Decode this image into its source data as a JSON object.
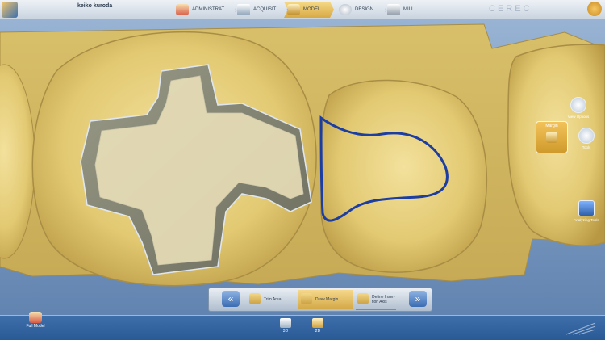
{
  "patient": {
    "name": "keiko kuroda"
  },
  "workflow": {
    "phases": [
      {
        "label": "ADMINISTRAT."
      },
      {
        "label": "ACQUISIT."
      },
      {
        "label": "MODEL"
      },
      {
        "label": "DESIGN"
      },
      {
        "label": "MILL"
      }
    ],
    "active_phase": "MODEL"
  },
  "brand": "CEREC",
  "tools": {
    "margin": "Margin",
    "view_options": "View Options",
    "tools": "Tools",
    "analyzing": "Analyzing Tools",
    "partial_sidebar_text": ""
  },
  "steps": {
    "items": [
      {
        "label": "Trim Area"
      },
      {
        "label": "Draw Margin"
      },
      {
        "label": "Define Inser-\ntion Axis"
      }
    ],
    "active": "Draw Margin"
  },
  "bottom": {
    "full_model": "Full Model",
    "view_3d": "3D",
    "view_2d": "2D"
  },
  "colors": {
    "tooth": "#e2cd79",
    "margin_line": "#1c3ea3",
    "accent": "#e0aa3e",
    "background": "#7f9dc4"
  },
  "icons": [
    "app-logo-icon",
    "admin-icon",
    "acquisition-icon",
    "model-icon",
    "design-icon",
    "mill-icon",
    "window-control-icon",
    "view-options-icon",
    "tools-icon",
    "analyzing-tools-icon",
    "margin-icon",
    "trim-area-icon",
    "draw-margin-icon",
    "insertion-axis-icon",
    "full-model-icon",
    "view-3d-icon",
    "view-2d-icon"
  ]
}
